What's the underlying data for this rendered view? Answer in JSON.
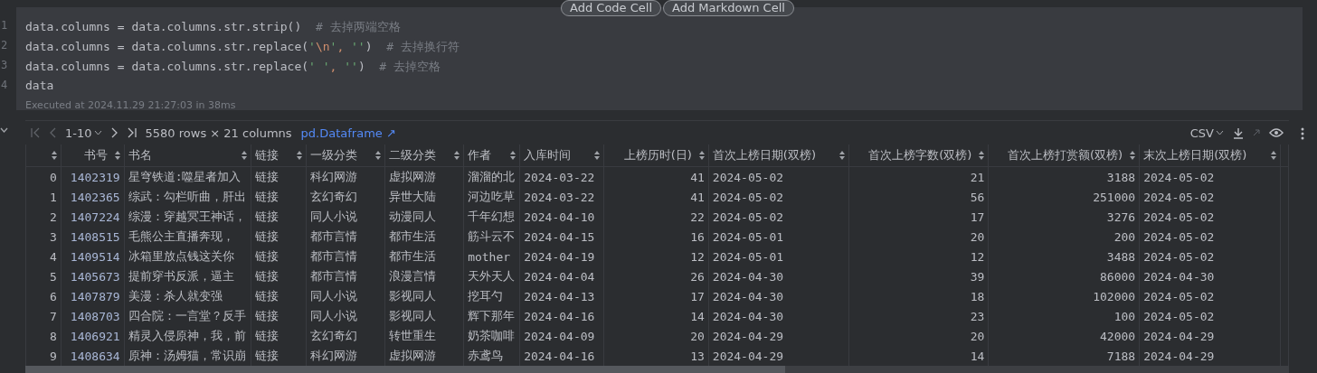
{
  "cell_toolbar": {
    "buttons": [
      "Add Code Cell",
      "Add Markdown Cell"
    ]
  },
  "code_cell": {
    "lines": [
      {
        "number": "1",
        "tokens": [
          {
            "kind": "plain",
            "text": "data.columns = data.columns.str.strip()  "
          },
          {
            "kind": "comment",
            "text": "# 去掉两端空格"
          }
        ]
      },
      {
        "number": "2",
        "tokens": [
          {
            "kind": "plain",
            "text": "data.columns = data.columns.str.replace("
          },
          {
            "kind": "string",
            "text": "'"
          },
          {
            "kind": "escape",
            "text": "\\n"
          },
          {
            "kind": "string",
            "text": "'"
          },
          {
            "kind": "punct",
            "text": ", "
          },
          {
            "kind": "string",
            "text": "''"
          },
          {
            "kind": "plain",
            "text": ")  "
          },
          {
            "kind": "comment",
            "text": "# 去掉换行符"
          }
        ]
      },
      {
        "number": "3",
        "tokens": [
          {
            "kind": "plain",
            "text": "data.columns = data.columns.str.replace("
          },
          {
            "kind": "string",
            "text": "' '"
          },
          {
            "kind": "punct",
            "text": ", "
          },
          {
            "kind": "string",
            "text": "''"
          },
          {
            "kind": "plain",
            "text": ")  "
          },
          {
            "kind": "comment",
            "text": "# 去掉空格"
          }
        ]
      },
      {
        "number": "4",
        "tokens": [
          {
            "kind": "plain",
            "text": "data"
          }
        ]
      }
    ],
    "status": "Executed at 2024.11.29 21:27:03 in 38ms"
  },
  "table": {
    "pager": {
      "range": "1-10",
      "summary": "5580 rows × 21 columns",
      "type_link": "pd.Dataframe ↗",
      "format": "CSV"
    },
    "columns": [
      {
        "kind": "number"
      },
      {
        "label": "书号",
        "kind": "number"
      },
      {
        "label": "书名",
        "kind": "text"
      },
      {
        "label": "链接",
        "kind": "text"
      },
      {
        "label": "一级分类",
        "kind": "text"
      },
      {
        "label": "二级分类",
        "kind": "text"
      },
      {
        "label": "作者",
        "kind": "text"
      },
      {
        "label": "入库时间",
        "kind": "text"
      },
      {
        "label": "上榜历时(日)",
        "kind": "number"
      },
      {
        "label": "首次上榜日期(双榜)",
        "kind": "text"
      },
      {
        "label": "首次上榜字数(双榜)",
        "kind": "number"
      },
      {
        "label": "首次上榜打赏额(双榜)",
        "kind": "number"
      },
      {
        "label": "末次上榜日期(双榜)",
        "kind": "text"
      }
    ],
    "rows": [
      [
        "0",
        "1402319",
        "星穹铁道:噬星者加入",
        "链接",
        "科幻网游",
        "虚拟网游",
        "溜溜的北",
        "2024-03-22",
        "41",
        "2024-05-02",
        "21",
        "3188",
        "2024-05-02"
      ],
      [
        "1",
        "1402365",
        "综武：勾栏听曲，肝出",
        "链接",
        "玄幻奇幻",
        "异世大陆",
        "河边吃草",
        "2024-03-22",
        "41",
        "2024-05-02",
        "56",
        "251000",
        "2024-05-02"
      ],
      [
        "2",
        "1407224",
        "综漫：穿越冥王神话，",
        "链接",
        "同人小说",
        "动漫同人",
        "千年幻想",
        "2024-04-10",
        "22",
        "2024-05-02",
        "17",
        "3276",
        "2024-05-02"
      ],
      [
        "3",
        "1408515",
        "毛熊公主直播奔现，",
        "链接",
        "都市言情",
        "都市生活",
        "筋斗云不",
        "2024-04-15",
        "16",
        "2024-05-01",
        "20",
        "200",
        "2024-05-02"
      ],
      [
        "4",
        "1409514",
        "冰箱里放点钱这关你",
        "链接",
        "都市言情",
        "都市生活",
        "mother",
        "2024-04-19",
        "12",
        "2024-05-01",
        "12",
        "3488",
        "2024-05-02"
      ],
      [
        "5",
        "1405673",
        "提前穿书反派，逼主",
        "链接",
        "都市言情",
        "浪漫言情",
        "天外天人",
        "2024-04-04",
        "26",
        "2024-04-30",
        "39",
        "86000",
        "2024-04-30"
      ],
      [
        "6",
        "1407879",
        "美漫：杀人就变强",
        "链接",
        "同人小说",
        "影视同人",
        "挖耳勺",
        "2024-04-13",
        "17",
        "2024-04-30",
        "18",
        "102000",
        "2024-05-02"
      ],
      [
        "7",
        "1408703",
        "四合院：一言堂？反手",
        "链接",
        "同人小说",
        "影视同人",
        "辉下那年",
        "2024-04-16",
        "14",
        "2024-04-30",
        "23",
        "100",
        "2024-05-02"
      ],
      [
        "8",
        "1406921",
        "精灵入侵原神，我，前",
        "链接",
        "玄幻奇幻",
        "转世重生",
        "奶茶咖啡",
        "2024-04-09",
        "20",
        "2024-04-29",
        "20",
        "42000",
        "2024-04-29"
      ],
      [
        "9",
        "1408634",
        "原神：汤姆猫，常识崩",
        "链接",
        "科幻网游",
        "虚拟网游",
        "赤鸢鸟",
        "2024-04-16",
        "13",
        "2024-04-29",
        "14",
        "7188",
        "2024-04-29"
      ]
    ]
  }
}
